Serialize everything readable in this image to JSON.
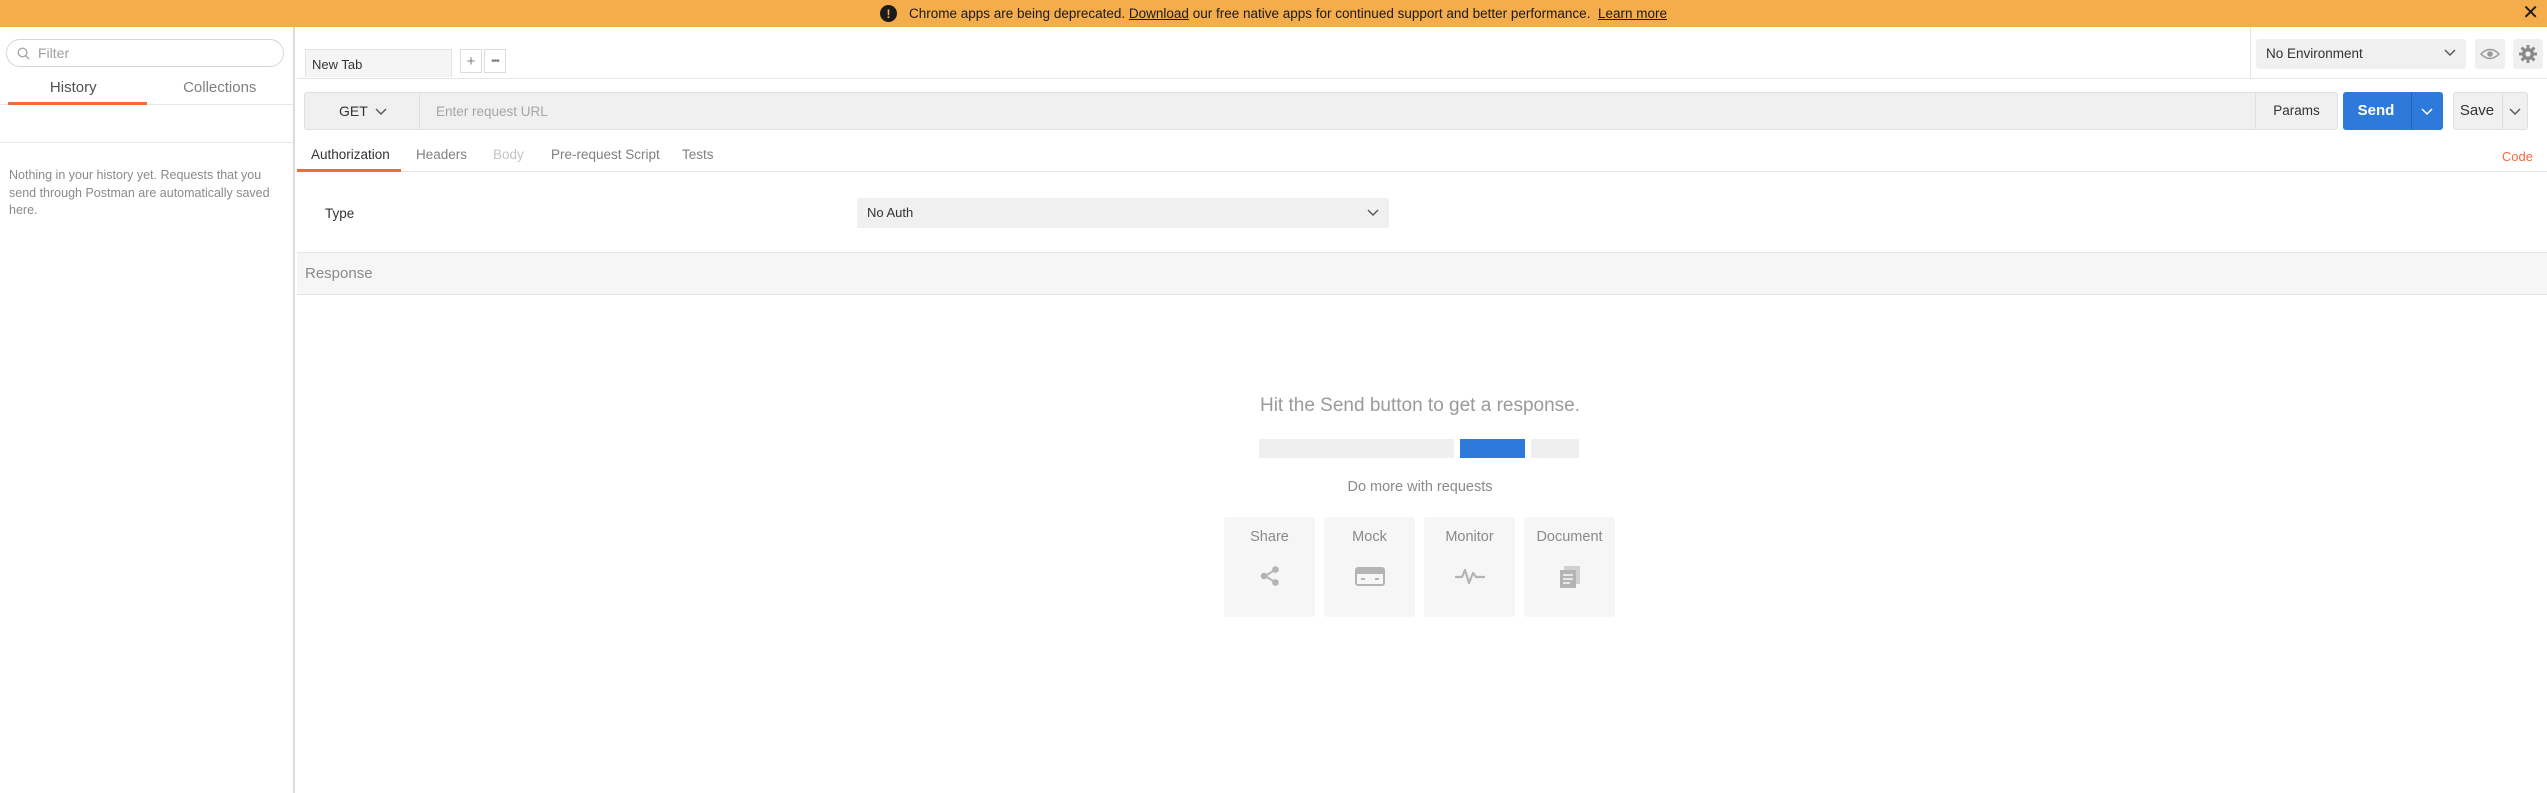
{
  "banner": {
    "text_before": "Chrome apps are being deprecated.",
    "download_link": "Download",
    "text_after": "our free native apps for continued support and better performance.",
    "learn_more": "Learn more",
    "close": "✕",
    "background": "#f5ad4c"
  },
  "sidebar": {
    "filter_placeholder": "Filter",
    "tabs": [
      {
        "label": "History",
        "active": true
      },
      {
        "label": "Collections",
        "active": false
      }
    ],
    "empty_message": "Nothing in your history yet. Requests that you send through Postman are automatically saved here."
  },
  "tabs": {
    "open": [
      {
        "label": "New Tab"
      }
    ],
    "add": "+",
    "more": "•••"
  },
  "environment": {
    "selected": "No Environment",
    "icons": [
      "eye-icon",
      "gear-icon"
    ]
  },
  "request": {
    "method": "GET",
    "url_placeholder": "Enter request URL",
    "params_label": "Params",
    "send_label": "Send",
    "save_label": "Save",
    "accent": "#2e7adb"
  },
  "request_tabs": {
    "items": [
      {
        "label": "Authorization",
        "state": "active"
      },
      {
        "label": "Headers",
        "state": "normal"
      },
      {
        "label": "Body",
        "state": "disabled"
      },
      {
        "label": "Pre-request Script",
        "state": "normal"
      },
      {
        "label": "Tests",
        "state": "normal"
      }
    ],
    "code_link": "Code",
    "accent": "#f26b3a"
  },
  "auth": {
    "type_label": "Type",
    "selected": "No Auth"
  },
  "response": {
    "header": "Response",
    "hint": "Hit the Send button to get a response.",
    "do_more": "Do more with requests",
    "actions": [
      {
        "label": "Share",
        "icon": "share-icon"
      },
      {
        "label": "Mock",
        "icon": "mock-server-icon"
      },
      {
        "label": "Monitor",
        "icon": "monitor-pulse-icon"
      },
      {
        "label": "Document",
        "icon": "document-icon"
      }
    ]
  }
}
